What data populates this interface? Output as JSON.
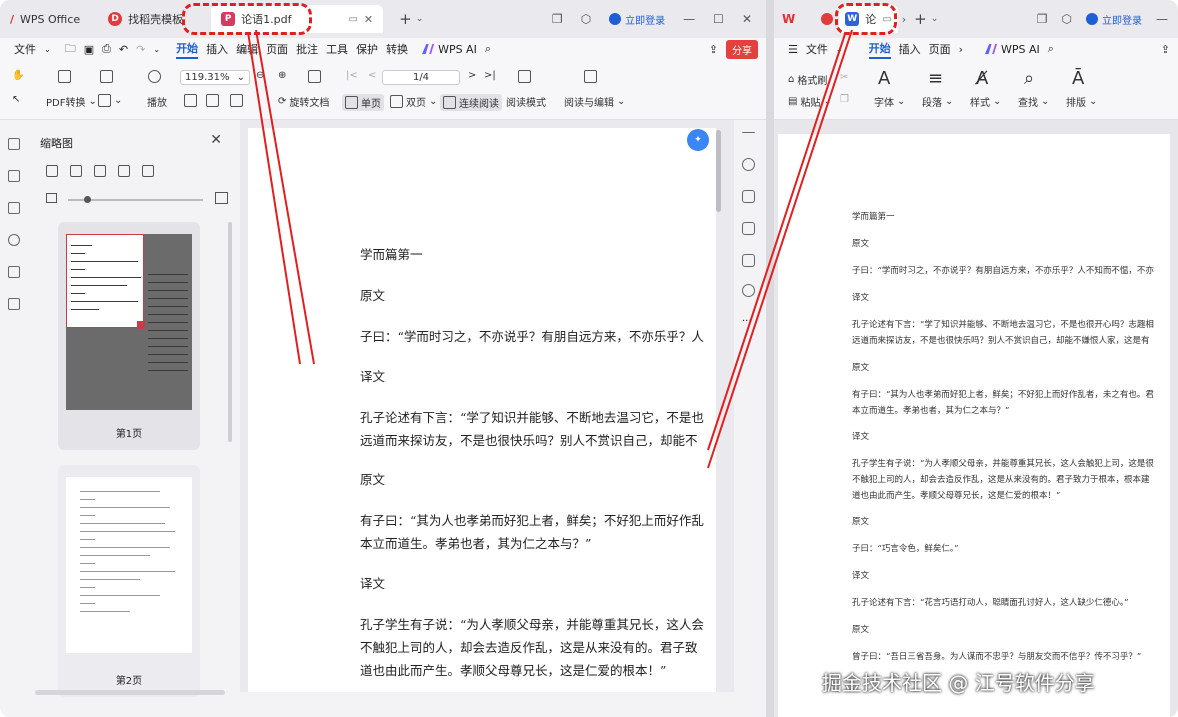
{
  "left_window": {
    "tabs": [
      {
        "label": "WPS Office"
      },
      {
        "label": "找稻壳模板"
      },
      {
        "label": "论语1.pdf"
      }
    ],
    "login_label": "立即登录",
    "menu": [
      "文件",
      "开始",
      "插入",
      "编辑",
      "页面",
      "批注",
      "工具",
      "保护",
      "转换"
    ],
    "wps_ai": "WPS AI",
    "share_label": "分享",
    "ribbon": {
      "pdf_convert": "PDF转换",
      "play": "播放",
      "zoom": "119.31%",
      "page_indicator": "1/4",
      "rotate": "旋转文档",
      "single_page": "单页",
      "double_page": "双页",
      "continuous": "连续阅读",
      "read_mode": "阅读模式",
      "read_edit": "阅读与编辑"
    },
    "thumbnails": {
      "title": "缩略图",
      "pages": [
        {
          "label": "第1页"
        },
        {
          "label": "第2页"
        }
      ]
    },
    "document": {
      "lines": [
        "学而篇第一",
        "原文",
        "子曰：“学而时习之，不亦说乎？有朋自远方来，不亦乐乎？人",
        "译文",
        "孔子论述有下言：“学了知识并能够、不断地去温习它，不是也",
        "远道而来探访友，不是也很快乐吗？别人不赏识自己，却能不",
        "原文",
        "有子曰：“其为人也孝弟而好犯上者，鲜矣；不好犯上而好作乱",
        "本立而道生。孝弟也者，其为仁之本与？”",
        "译文",
        "孔子学生有子说：“为人孝顺父母亲，并能尊重其兄长，这人会",
        "不触犯上司的人，却会去造反作乱，这是从来没有的。君子致",
        "道也由此而产生。孝顺父母尊兄长，这是仁爱的根本！”"
      ]
    }
  },
  "right_window": {
    "tab_label": "论",
    "login_label": "立即登录",
    "menu": [
      "文件",
      "开始",
      "插入",
      "页面"
    ],
    "wps_ai": "WPS AI",
    "ribbon": {
      "format_painter": "格式刷",
      "paste": "粘贴",
      "font": "字体",
      "paragraph": "段落",
      "style": "样式",
      "find": "查找",
      "layout": "排版"
    },
    "document": {
      "lines": [
        "学而篇第一",
        "原文",
        "子曰：“学而时习之，不亦说乎？有朋自远方来，不亦乐乎？人不知而不愠，不亦",
        "译文",
        "孔子论述有下言：“学了知识并能够、不断地去温习它，不是也很开心吗？志趣相",
        "远道而来探访友，不是也很快乐吗？别人不赏识自己，却能不嫌恨人家，这是有",
        "原文",
        "有子曰：“其为人也孝弟而好犯上者，鲜矣；不好犯上而好作乱者，未之有也。君",
        "本立而道生。孝弟也者，其为仁之本与？”",
        "译文",
        "孔子学生有子说：“为人孝顺父母亲，并能尊重其兄长，这人会触犯上司，这是很",
        "不触犯上司的人，却会去造反作乱，这是从来没有的。君子致力于根本，根本建",
        "道也由此而产生。孝顺父母尊兄长，这是仁爱的根本！”",
        "原文",
        "子曰：“巧言令色，鲜矣仁。”",
        "译文",
        "孔子论述有下言：“花言巧语打动人，聪睛面孔讨好人，这人缺少仁德心。”",
        "原文",
        "曾子曰：“吾日三省吾身。为人谋而不忠乎？与朋友交而不信乎？传不习乎？”"
      ]
    }
  },
  "watermark": "掘金技术社区 @ 江号软件分享",
  "colors": {
    "accent": "#1f5fd6",
    "annotation": "#e02020",
    "pdf_icon": "#d9395f",
    "word_icon": "#2f62d8",
    "wps_icon": "#e03131"
  }
}
